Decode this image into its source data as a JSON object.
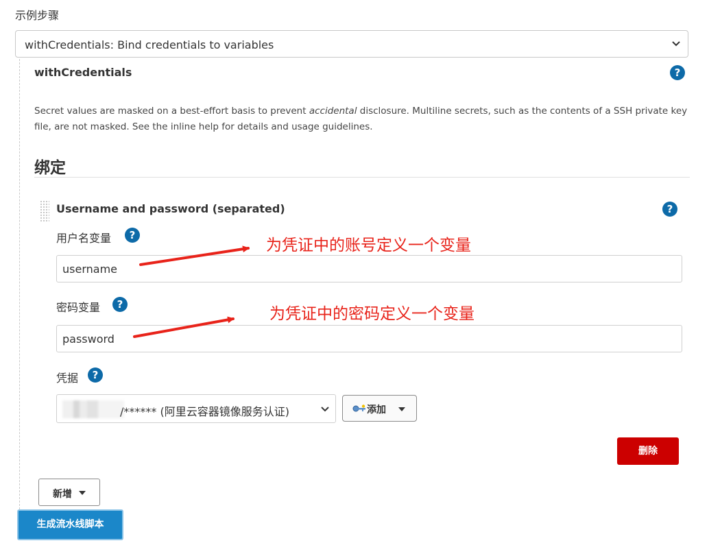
{
  "section_label": "示例步骤",
  "step_select": {
    "value": "withCredentials: Bind credentials to variables"
  },
  "with_credentials": {
    "title": "withCredentials",
    "help": "?",
    "description_part1": "Secret values are masked on a best-effort basis to prevent ",
    "description_em": "accidental",
    "description_part2": " disclosure. Multiline secrets, such as the contents of a SSH private key file, are not masked. See the inline help for details and usage guidelines."
  },
  "bindings": {
    "title": "绑定",
    "item": {
      "title": "Username and password (separated)",
      "help": "?",
      "username_label": "用户名变量",
      "username_value": "username",
      "password_label": "密码变量",
      "password_value": "password",
      "credentials_label": "凭据",
      "credentials_value": "/****** (阿里云容器镜像服务认证)",
      "add_button": "添加",
      "delete_button": "删除"
    }
  },
  "annotations": {
    "username_note": "为凭证中的账号定义一个变量",
    "password_note": "为凭证中的密码定义一个变量"
  },
  "new_button": "新增",
  "generate_button": "生成流水线脚本",
  "colors": {
    "help_icon": "#0d6aa8",
    "annotation": "#e8231a",
    "delete_button": "#cc0000",
    "generate_button": "#1b87c9"
  }
}
